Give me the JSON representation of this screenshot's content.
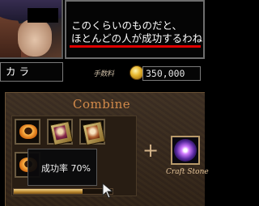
{
  "dialog": {
    "line1": "このくらいのものだと、",
    "line2": "ほとんどの人が成功するわね",
    "underline_color": "#e10000"
  },
  "character": {
    "name": "カラ"
  },
  "fee": {
    "label": "手数料",
    "value": "350,000",
    "icon": "gold-coin-icon"
  },
  "combine": {
    "title": "Combine",
    "slots": [
      {
        "icon": "ring-icon"
      },
      {
        "icon": "card-icon"
      },
      {
        "icon": "card-icon"
      },
      {
        "icon": "ring-icon"
      }
    ],
    "plus_symbol": "+",
    "stone_label": "Craft Stone",
    "stone_icon": "craft-stone-icon",
    "success_rate_text": "成功率 70%",
    "success_rate": 0.7
  }
}
